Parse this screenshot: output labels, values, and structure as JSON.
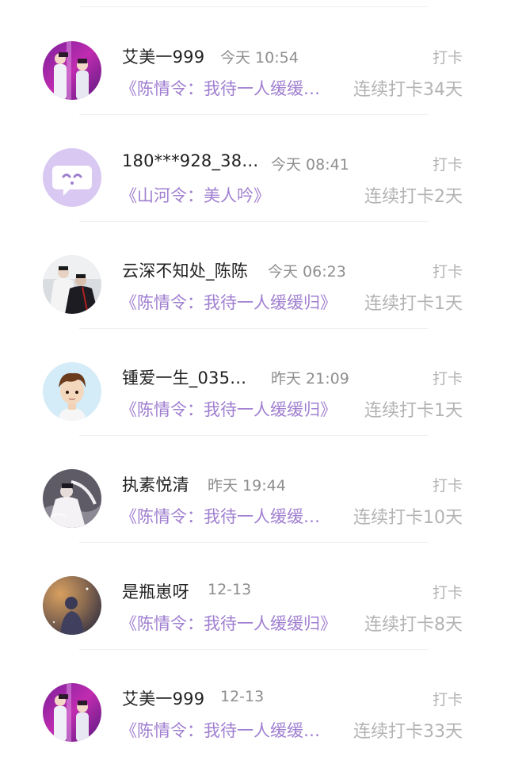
{
  "entries": [
    {
      "avatar": "idol-photo-avatar",
      "name": "艾美一999",
      "time": "今天 10:54",
      "action": "打卡",
      "book": "《陈情令：我待一人缓缓…",
      "streak": "连续打卡34天"
    },
    {
      "avatar": "default-cartoon-avatar",
      "name": "180***928_38…",
      "time": "今天 08:41",
      "action": "打卡",
      "book": "《山河令：美人吟》",
      "streak": "连续打卡2天"
    },
    {
      "avatar": "drama-poster-avatar",
      "name": "云深不知处_陈陈",
      "time": "今天 06:23",
      "action": "打卡",
      "book": "《陈情令：我待一人缓缓归》",
      "streak": "连续打卡1天"
    },
    {
      "avatar": "cartoon-boy-avatar",
      "name": "锺爱一生_035…",
      "time": "昨天 21:09",
      "action": "打卡",
      "book": "《陈情令：我待一人缓缓归》",
      "streak": "连续打卡1天"
    },
    {
      "avatar": "ink-painting-avatar",
      "name": "执素悦清",
      "time": "昨天 19:44",
      "action": "打卡",
      "book": "《陈情令：我待一人缓缓…",
      "streak": "连续打卡10天"
    },
    {
      "avatar": "night-sky-avatar",
      "name": "是瓶崽呀",
      "time": "12-13",
      "action": "打卡",
      "book": "《陈情令：我待一人缓缓归》",
      "streak": "连续打卡8天"
    },
    {
      "avatar": "idol-photo-avatar",
      "name": "艾美一999",
      "time": "12-13",
      "action": "打卡",
      "book": "《陈情令：我待一人缓缓…",
      "streak": "连续打卡33天"
    }
  ],
  "colors": {
    "accent_purple": "#a07fd0",
    "name_text": "#222222",
    "time_text": "#8e8e8e",
    "muted_text": "#b3b3b3",
    "divider": "#f0f0f0"
  }
}
